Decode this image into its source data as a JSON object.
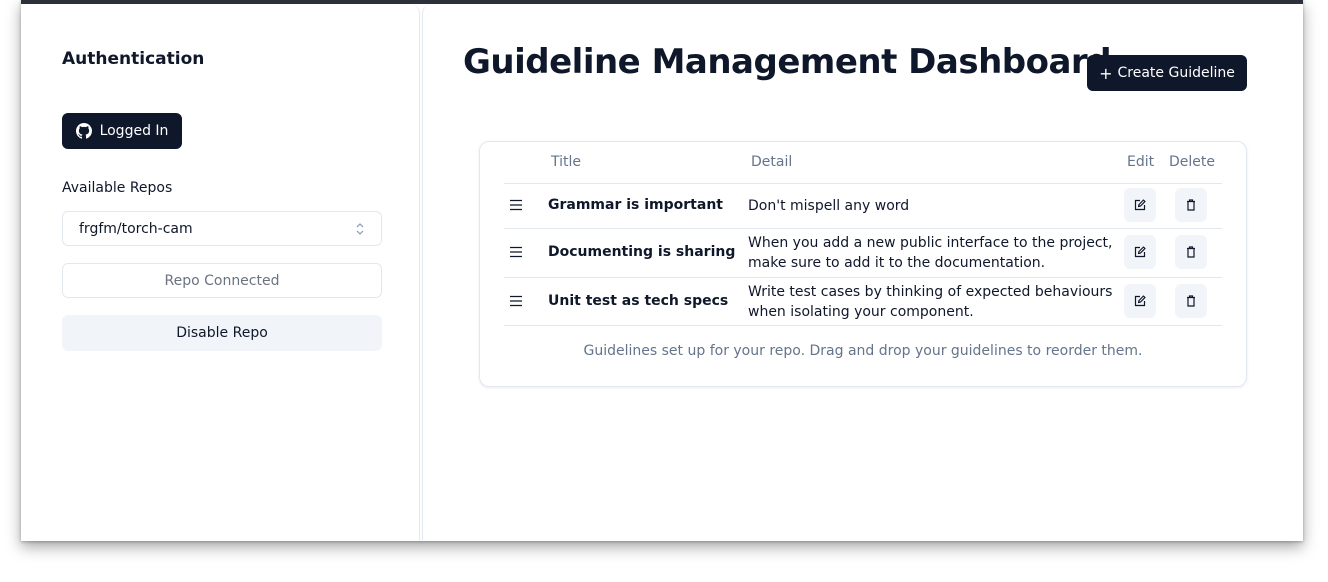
{
  "sidebar": {
    "heading": "Authentication",
    "login_button": "Logged In",
    "repos_label": "Available Repos",
    "selected_repo": "frgfm/torch-cam",
    "repo_status": "Repo Connected",
    "disable_button": "Disable Repo"
  },
  "main": {
    "title": "Guideline Management Dashboard",
    "create_button": "Create Guideline",
    "table": {
      "headers": {
        "title": "Title",
        "detail": "Detail",
        "edit": "Edit",
        "delete": "Delete"
      },
      "rows": [
        {
          "title": "Grammar is important",
          "detail": "Don't mispell any word"
        },
        {
          "title": "Documenting is sharing",
          "detail": "When you add a new public interface to the project, make sure to add it to the documentation."
        },
        {
          "title": "Unit test as tech specs",
          "detail": "Write test cases by thinking of expected behaviours when isolating your component."
        }
      ],
      "caption": "Guidelines set up for your repo. Drag and drop your guidelines to reorder them."
    }
  },
  "colors": {
    "primary": "#0f172a",
    "muted_text": "#64748b",
    "border": "#e2e8f0",
    "secondary_bg": "#f1f5f9"
  },
  "icons": {
    "login": "github-icon",
    "select": "chevron-up-down-icon",
    "create": "plus-icon",
    "drag": "drag-handle-icon",
    "edit": "edit-icon",
    "delete": "trash-icon"
  }
}
